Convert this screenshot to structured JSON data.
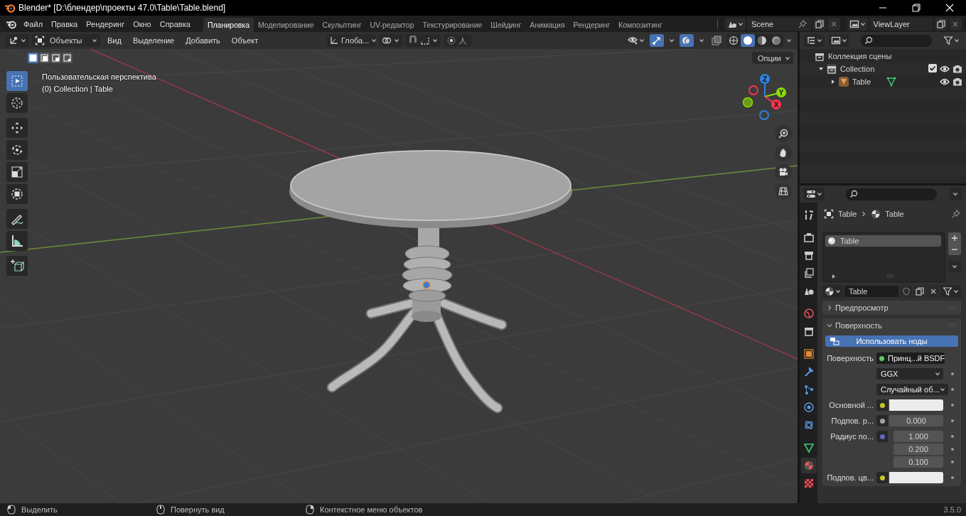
{
  "window": {
    "title": "Blender* [D:\\блендер\\проекты 47.0\\Table\\Table.blend]"
  },
  "menu": [
    "Файл",
    "Правка",
    "Рендеринг",
    "Окно",
    "Справка"
  ],
  "workspaces": [
    {
      "label": "Планировка",
      "selected": true
    },
    {
      "label": "Моделирование",
      "selected": false
    },
    {
      "label": "Скульптинг",
      "selected": false
    },
    {
      "label": "UV-редактор",
      "selected": false
    },
    {
      "label": "Текстурирование",
      "selected": false
    },
    {
      "label": "Шейдинг",
      "selected": false
    },
    {
      "label": "Анимация",
      "selected": false
    },
    {
      "label": "Рендеринг",
      "selected": false
    },
    {
      "label": "Композитинг",
      "selected": false
    }
  ],
  "scene": {
    "value": "Scene"
  },
  "view_layer": {
    "value": "ViewLayer"
  },
  "viewport": {
    "mode": "Объекты",
    "menus": [
      "Вид",
      "Выделение",
      "Добавить",
      "Объект"
    ],
    "orientation": "Глоба...",
    "snap": {
      "on": false
    },
    "proportional": {
      "on": false
    },
    "shading": [
      {
        "selected": false
      },
      {
        "selected": true
      },
      {
        "selected": false
      },
      {
        "selected": false
      }
    ],
    "select_modes": [
      {
        "selected": true
      },
      {
        "selected": false
      },
      {
        "selected": false
      },
      {
        "selected": false
      }
    ],
    "options": "Опции",
    "info": [
      "Пользовательская перспектива",
      "(0) Collection | Table"
    ],
    "tools": [
      {
        "kind": "select_box",
        "selected": true
      },
      {
        "kind": "cursor",
        "selected": false
      },
      {
        "kind": "move",
        "selected": false
      },
      {
        "kind": "rotate",
        "selected": false
      },
      {
        "kind": "scale",
        "selected": false
      },
      {
        "kind": "transform",
        "selected": false
      },
      {
        "kind": "annotate",
        "selected": false
      },
      {
        "kind": "measure",
        "selected": false
      },
      {
        "kind": "add_cube",
        "selected": false
      }
    ],
    "gizmo_axes": [
      "Z",
      "Y",
      "X"
    ]
  },
  "outliner": {
    "tree": [
      {
        "kind": "scene_collection",
        "label": "Коллекция сцены",
        "children": [
          {
            "kind": "collection",
            "label": "Collection",
            "expanded": true,
            "checked": true,
            "children": [
              {
                "kind": "object",
                "label": "Table",
                "expanded": false
              }
            ]
          }
        ]
      }
    ]
  },
  "properties": {
    "tabs": [
      {
        "kind": "tool",
        "selected": false
      },
      {
        "kind": "render",
        "selected": false
      },
      {
        "kind": "output",
        "selected": false
      },
      {
        "kind": "view_layer",
        "selected": false
      },
      {
        "kind": "scene",
        "selected": false
      },
      {
        "kind": "world",
        "selected": false
      },
      {
        "kind": "collection",
        "selected": false
      },
      {
        "kind": "object",
        "selected": false
      },
      {
        "kind": "modifiers",
        "selected": false
      },
      {
        "kind": "particles",
        "selected": false
      },
      {
        "kind": "physics",
        "selected": false
      },
      {
        "kind": "constraints",
        "selected": false
      },
      {
        "kind": "data",
        "selected": false
      },
      {
        "kind": "material",
        "selected": true
      },
      {
        "kind": "texture",
        "selected": false
      }
    ],
    "breadcrumb": [
      "Table",
      "Table"
    ],
    "slots": [
      {
        "label": "Table",
        "selected": true
      }
    ],
    "material": "Table",
    "panels": [
      {
        "label": "Предпросмотр",
        "expanded": false
      },
      {
        "label": "Поверхность",
        "expanded": true,
        "use_nodes": "Использовать ноды",
        "fields": [
          {
            "kind": "link",
            "label": "Поверхность",
            "color": "#63c763",
            "value": "Принц...й BSDF"
          },
          {
            "kind": "dropdown",
            "value": "GGX"
          },
          {
            "kind": "dropdown",
            "value": "Случайный об..."
          },
          {
            "kind": "color",
            "label": "Основной ...",
            "color": "#c7c729"
          },
          {
            "kind": "number",
            "label": "Подпов. р...",
            "color": "#a1a1a1",
            "value": "0.000"
          },
          {
            "kind": "vector",
            "label": "Радиус по...",
            "color": "#6363c7",
            "values": [
              "1.000",
              "0.200",
              "0.100"
            ]
          },
          {
            "kind": "color",
            "label": "Подпов. цв...",
            "color": "#c7c729"
          }
        ]
      }
    ]
  },
  "status_bar": {
    "hints": [
      {
        "kind": "left",
        "label": "Выделить"
      },
      {
        "kind": "middle",
        "label": "Повернуть вид"
      },
      {
        "kind": "right",
        "label": "Контекстное меню объектов"
      }
    ],
    "version": "3.5.0"
  }
}
